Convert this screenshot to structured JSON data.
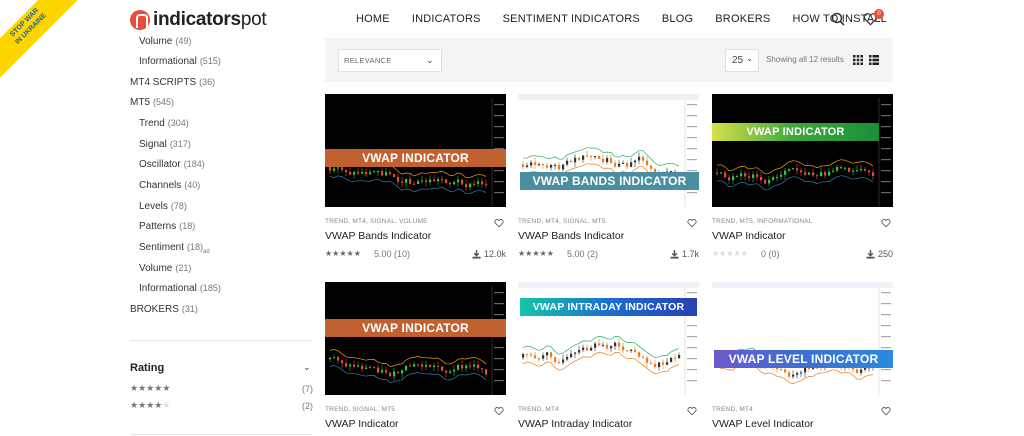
{
  "ribbon": {
    "line1": "STOP WAR",
    "line2": "IN UKRAINE"
  },
  "header": {
    "logo_bold": "indicators",
    "logo_light": "pot",
    "nav": [
      "HOME",
      "INDICATORS",
      "SENTIMENT INDICATORS",
      "BLOG",
      "BROKERS",
      "HOW TO INSTALL"
    ],
    "cart_count": "0",
    "icons": {
      "search": "search-icon",
      "wishlist": "heart-icon"
    }
  },
  "sidebar": {
    "categories": [
      {
        "label": "Volume",
        "count": "(49)",
        "level": 1
      },
      {
        "label": "Informational",
        "count": "(515)",
        "level": 1
      },
      {
        "label": "MT4 SCRIPTS",
        "count": "(36)",
        "level": 0
      },
      {
        "label": "MT5",
        "count": "(545)",
        "level": 0
      },
      {
        "label": "Trend",
        "count": "(304)",
        "level": 1
      },
      {
        "label": "Signal",
        "count": "(317)",
        "level": 1
      },
      {
        "label": "Oscillator",
        "count": "(184)",
        "level": 1
      },
      {
        "label": "Channels",
        "count": "(40)",
        "level": 1
      },
      {
        "label": "Levels",
        "count": "(78)",
        "level": 1
      },
      {
        "label": "Patterns",
        "count": "(18)",
        "level": 1
      },
      {
        "label": "Sentiment",
        "count": "(18)",
        "level": 1,
        "suffix": "ad"
      },
      {
        "label": "Volume",
        "count": "(21)",
        "level": 1
      },
      {
        "label": "Informational",
        "count": "(185)",
        "level": 1
      },
      {
        "label": "BROKERS",
        "count": "(31)",
        "level": 0
      }
    ],
    "rating": {
      "title": "Rating",
      "rows": [
        {
          "stars": 5,
          "count": "(7)"
        },
        {
          "stars": 4,
          "count": "(2)"
        }
      ]
    }
  },
  "toolbar": {
    "sort_value": "RELEVANCE",
    "per_page": "25",
    "showing": "Showing all 12 results"
  },
  "products": [
    {
      "banner": "VWAP INDICATOR",
      "banner_color": "#c0612f",
      "cats": "TREND, MT4, SIGNAL, VOLUME",
      "title": "VWAP Bands Indicator",
      "stars": 5,
      "rating": "5.00 (10)",
      "downloads": "12.0k",
      "theme": "dark"
    },
    {
      "banner": "VWAP BANDS INDICATOR",
      "banner_color": "#4a8fa0",
      "cats": "TREND, MT4, SIGNAL, MT5",
      "title": "VWAP Bands Indicator",
      "stars": 5,
      "rating": "5.00 (2)",
      "downloads": "1.7k",
      "theme": "light"
    },
    {
      "banner": "VWAP INDICATOR",
      "banner_color": "#3aa83a",
      "cats": "TREND, MT5, INFORMATIONAL",
      "title": "VWAP Indicator",
      "stars": 0,
      "rating": "0 (0)",
      "downloads": "250",
      "theme": "dark"
    },
    {
      "banner": "VWAP INDICATOR",
      "banner_color": "#c0612f",
      "cats": "TREND, SIGNAL, MT5",
      "title": "VWAP Indicator",
      "theme": "dark"
    },
    {
      "banner": "VWAP INTRADAY INDICATOR",
      "banner_color": "#1a72c4",
      "cats": "TREND, MT4",
      "title": "VWAP Intraday Indicator",
      "theme": "light"
    },
    {
      "banner": "VWAP LEVEL INDICATOR",
      "banner_color": "#3b6fd4",
      "cats": "TREND, MT4",
      "title": "VWAP Level Indicator",
      "theme": "light"
    }
  ]
}
